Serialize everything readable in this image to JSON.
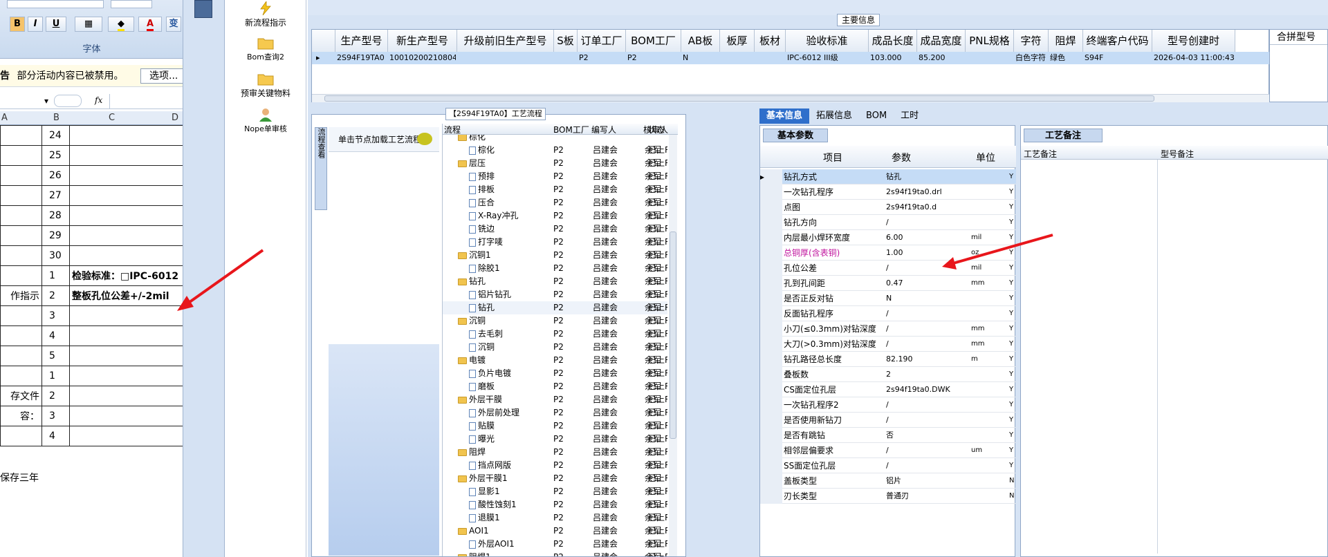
{
  "excel": {
    "ribbon": {
      "group_label": "字体",
      "bold": "B",
      "italic": "I",
      "underline": "U",
      "font_color": "A",
      "wrap_label": "变"
    },
    "security_warning": {
      "prefix": "告",
      "message": "部分活动内容已被禁用。",
      "options_button": "选项..."
    },
    "formula_label": "fx",
    "columns": [
      "A",
      "B",
      "C",
      "D"
    ],
    "rows": [
      {
        "a": "",
        "b": "24",
        "c": ""
      },
      {
        "a": "",
        "b": "25",
        "c": ""
      },
      {
        "a": "",
        "b": "26",
        "c": ""
      },
      {
        "a": "",
        "b": "27",
        "c": ""
      },
      {
        "a": "",
        "b": "28",
        "c": ""
      },
      {
        "a": "",
        "b": "29",
        "c": ""
      },
      {
        "a": "",
        "b": "30",
        "c": ""
      },
      {
        "a": "",
        "b": "1",
        "c": "检验标准：□IPC-6012"
      },
      {
        "a": "作指示",
        "b": "2",
        "c": "整板孔位公差+/-2mil"
      },
      {
        "a": "",
        "b": "3",
        "c": ""
      },
      {
        "a": "",
        "b": "4",
        "c": ""
      },
      {
        "a": "",
        "b": "5",
        "c": ""
      },
      {
        "a": "",
        "b": "1",
        "c": ""
      },
      {
        "a": "存文件",
        "b": "2",
        "c": ""
      },
      {
        "a": "容：",
        "b": "3",
        "c": ""
      },
      {
        "a": "",
        "b": "4",
        "c": ""
      }
    ],
    "footer_text": "保存三年"
  },
  "nav": {
    "items": [
      {
        "label": "新流程指示",
        "icon": "lightning-icon"
      },
      {
        "label": "Bom查询2",
        "icon": "folder-icon"
      },
      {
        "label": "预审关键物料",
        "icon": "folder-icon"
      },
      {
        "label": "Nope单审核",
        "icon": "user-icon"
      }
    ]
  },
  "main_info": {
    "title": "主要信息",
    "columns": [
      "生产型号",
      "新生产型号",
      "升级前旧生产型号",
      "S板",
      "订单工厂",
      "BOM工厂",
      "AB板",
      "板厚",
      "板材",
      "验收标准",
      "成品长度",
      "成品宽度",
      "PNL规格",
      "字符",
      "阻焊",
      "终端客户代码",
      "型号创建时"
    ],
    "row": [
      "2S94F19TA0",
      "10010200210804",
      "",
      "",
      "P2",
      "P2",
      "N",
      "",
      "",
      "IPC-6012 III级",
      "103.000",
      "85.200",
      "",
      "白色字符",
      "绿色",
      "S94F",
      "2026-04-03 11:00:43"
    ],
    "side_header": "合拼型号"
  },
  "flow": {
    "title": "【2S94F19TA0】工艺流程",
    "side_tab": "流程查看",
    "hint": "单击节点加载工艺流程",
    "columns": [
      "流程",
      "BOM工厂",
      "编写人",
      "核审人",
      "状态"
    ],
    "rows": [
      {
        "name": "棕化",
        "level": 1,
        "type": "folder",
        "bom": "",
        "writer": "",
        "checker": "",
        "status": ""
      },
      {
        "name": "棕化",
        "level": 2,
        "type": "doc",
        "bom": "P2",
        "writer": "吕建会",
        "checker": "余军",
        "status": "已上R"
      },
      {
        "name": "层压",
        "level": 1,
        "type": "folder",
        "bom": "P2",
        "writer": "吕建会",
        "checker": "余军",
        "status": "已上R"
      },
      {
        "name": "预排",
        "level": 2,
        "type": "doc",
        "bom": "P2",
        "writer": "吕建会",
        "checker": "余军",
        "status": "已上R"
      },
      {
        "name": "排板",
        "level": 2,
        "type": "doc",
        "bom": "P2",
        "writer": "吕建会",
        "checker": "余军",
        "status": "已上R"
      },
      {
        "name": "压合",
        "level": 2,
        "type": "doc",
        "bom": "P2",
        "writer": "吕建会",
        "checker": "余军",
        "status": "已上R"
      },
      {
        "name": "X-Ray冲孔",
        "level": 2,
        "type": "doc",
        "bom": "P2",
        "writer": "吕建会",
        "checker": "余军",
        "status": "已上R"
      },
      {
        "name": "铣边",
        "level": 2,
        "type": "doc",
        "bom": "P2",
        "writer": "吕建会",
        "checker": "余军",
        "status": "已上R"
      },
      {
        "name": "打字唛",
        "level": 2,
        "type": "doc",
        "bom": "P2",
        "writer": "吕建会",
        "checker": "余军",
        "status": "已上R"
      },
      {
        "name": "沉铜1",
        "level": 1,
        "type": "folder",
        "bom": "P2",
        "writer": "吕建会",
        "checker": "余军",
        "status": "已上R"
      },
      {
        "name": "除胶1",
        "level": 2,
        "type": "doc",
        "bom": "P2",
        "writer": "吕建会",
        "checker": "余军",
        "status": "已上R"
      },
      {
        "name": "钻孔",
        "level": 1,
        "type": "folder",
        "bom": "P2",
        "writer": "吕建会",
        "checker": "余军",
        "status": "已上R"
      },
      {
        "name": "铝片钻孔",
        "level": 2,
        "type": "doc",
        "bom": "P2",
        "writer": "吕建会",
        "checker": "余军",
        "status": "已上R"
      },
      {
        "name": "钻孔",
        "level": 2,
        "type": "doc",
        "bom": "P2",
        "writer": "吕建会",
        "checker": "余军",
        "status": "已上R"
      },
      {
        "name": "沉铜",
        "level": 1,
        "type": "folder",
        "bom": "P2",
        "writer": "吕建会",
        "checker": "余军",
        "status": "已上R"
      },
      {
        "name": "去毛刺",
        "level": 2,
        "type": "doc",
        "bom": "P2",
        "writer": "吕建会",
        "checker": "余军",
        "status": "已上R"
      },
      {
        "name": "沉铜",
        "level": 2,
        "type": "doc",
        "bom": "P2",
        "writer": "吕建会",
        "checker": "余军",
        "status": "已上R"
      },
      {
        "name": "电镀",
        "level": 1,
        "type": "folder",
        "bom": "P2",
        "writer": "吕建会",
        "checker": "余军",
        "status": "已上R"
      },
      {
        "name": "负片电镀",
        "level": 2,
        "type": "doc",
        "bom": "P2",
        "writer": "吕建会",
        "checker": "余军",
        "status": "已上R"
      },
      {
        "name": "磨板",
        "level": 2,
        "type": "doc",
        "bom": "P2",
        "writer": "吕建会",
        "checker": "余军",
        "status": "已上R"
      },
      {
        "name": "外层干膜",
        "level": 1,
        "type": "folder",
        "bom": "P2",
        "writer": "吕建会",
        "checker": "余军",
        "status": "已上R"
      },
      {
        "name": "外层前处理",
        "level": 2,
        "type": "doc",
        "bom": "P2",
        "writer": "吕建会",
        "checker": "余军",
        "status": "已上R"
      },
      {
        "name": "贴膜",
        "level": 2,
        "type": "doc",
        "bom": "P2",
        "writer": "吕建会",
        "checker": "余军",
        "status": "已上R"
      },
      {
        "name": "曝光",
        "level": 2,
        "type": "doc",
        "bom": "P2",
        "writer": "吕建会",
        "checker": "余军",
        "status": "已上R"
      },
      {
        "name": "阻焊",
        "level": 1,
        "type": "folder",
        "bom": "P2",
        "writer": "吕建会",
        "checker": "余军",
        "status": "已上R"
      },
      {
        "name": "挡点网版",
        "level": 2,
        "type": "doc",
        "bom": "P2",
        "writer": "吕建会",
        "checker": "余军",
        "status": "已上R"
      },
      {
        "name": "外层干膜1",
        "level": 1,
        "type": "folder",
        "bom": "P2",
        "writer": "吕建会",
        "checker": "余军",
        "status": "已上R"
      },
      {
        "name": "显影1",
        "level": 2,
        "type": "doc",
        "bom": "P2",
        "writer": "吕建会",
        "checker": "余军",
        "status": "已上R"
      },
      {
        "name": "酸性蚀刻1",
        "level": 2,
        "type": "doc",
        "bom": "P2",
        "writer": "吕建会",
        "checker": "余军",
        "status": "已上R"
      },
      {
        "name": "退膜1",
        "level": 2,
        "type": "doc",
        "bom": "P2",
        "writer": "吕建会",
        "checker": "余军",
        "status": "已上R"
      },
      {
        "name": "AOI1",
        "level": 1,
        "type": "folder",
        "bom": "P2",
        "writer": "吕建会",
        "checker": "余军",
        "status": "已上R"
      },
      {
        "name": "外层AOI1",
        "level": 2,
        "type": "doc",
        "bom": "P2",
        "writer": "吕建会",
        "checker": "余军",
        "status": "已上R"
      },
      {
        "name": "阻焊1",
        "level": 1,
        "type": "folder",
        "bom": "P2",
        "writer": "吕建会",
        "checker": "余军",
        "status": "已上R"
      }
    ]
  },
  "params": {
    "tabs": [
      "基本信息",
      "拓展信息",
      "BOM",
      "工时"
    ],
    "subtab": "基本参数",
    "columns": [
      "项目",
      "参数",
      "单位"
    ],
    "rows": [
      {
        "item": "钻孔方式",
        "value": "钻孔",
        "unit": "",
        "flag": "Y"
      },
      {
        "item": "一次钻孔程序",
        "value": "2s94f19ta0.drl",
        "unit": "",
        "flag": "Y"
      },
      {
        "item": "点图",
        "value": "2s94f19ta0.d",
        "unit": "",
        "flag": "Y"
      },
      {
        "item": "钻孔方向",
        "value": "/",
        "unit": "",
        "flag": "Y"
      },
      {
        "item": "内层最小焊环宽度",
        "value": "6.00",
        "unit": "mil",
        "flag": "Y"
      },
      {
        "item": "总铜厚(含表铜)",
        "value": "1.00",
        "unit": "oz",
        "flag": "Y"
      },
      {
        "item": "孔位公差",
        "value": "/",
        "unit": "mil",
        "flag": "Y"
      },
      {
        "item": "孔到孔间距",
        "value": "0.47",
        "unit": "mm",
        "flag": "Y"
      },
      {
        "item": "是否正反对钻",
        "value": "N",
        "unit": "",
        "flag": "Y"
      },
      {
        "item": "反面钻孔程序",
        "value": "/",
        "unit": "",
        "flag": "Y"
      },
      {
        "item": "小刀(≤0.3mm)对钻深度",
        "value": "/",
        "unit": "mm",
        "flag": "Y"
      },
      {
        "item": "大刀(>0.3mm)对钻深度",
        "value": "/",
        "unit": "mm",
        "flag": "Y"
      },
      {
        "item": "钻孔路径总长度",
        "value": "82.190",
        "unit": "m",
        "flag": "Y"
      },
      {
        "item": "叠板数",
        "value": "2",
        "unit": "",
        "flag": "Y"
      },
      {
        "item": "CS面定位孔层",
        "value": "2s94f19ta0.DWK",
        "unit": "",
        "flag": "Y"
      },
      {
        "item": "一次钻孔程序2",
        "value": "/",
        "unit": "",
        "flag": "Y"
      },
      {
        "item": "是否使用新钻刀",
        "value": "/",
        "unit": "",
        "flag": "Y"
      },
      {
        "item": "是否有跳钻",
        "value": "否",
        "unit": "",
        "flag": "Y"
      },
      {
        "item": "相邻层偏要求",
        "value": "/",
        "unit": "um",
        "flag": "Y"
      },
      {
        "item": "SS面定位孔层",
        "value": "/",
        "unit": "",
        "flag": "Y"
      },
      {
        "item": "盖板类型",
        "value": "铝片",
        "unit": "",
        "flag": "N"
      },
      {
        "item": "刃长类型",
        "value": "普通刃",
        "unit": "",
        "flag": "N"
      }
    ]
  },
  "notes": {
    "tab": "工艺备注",
    "columns": [
      "工艺备注",
      "型号备注"
    ]
  },
  "colors": {
    "accent": "#2f6fcb",
    "arrow": "#e8161b",
    "highlight_text": "#c0149e",
    "selected_row": "#c5dcf6"
  }
}
